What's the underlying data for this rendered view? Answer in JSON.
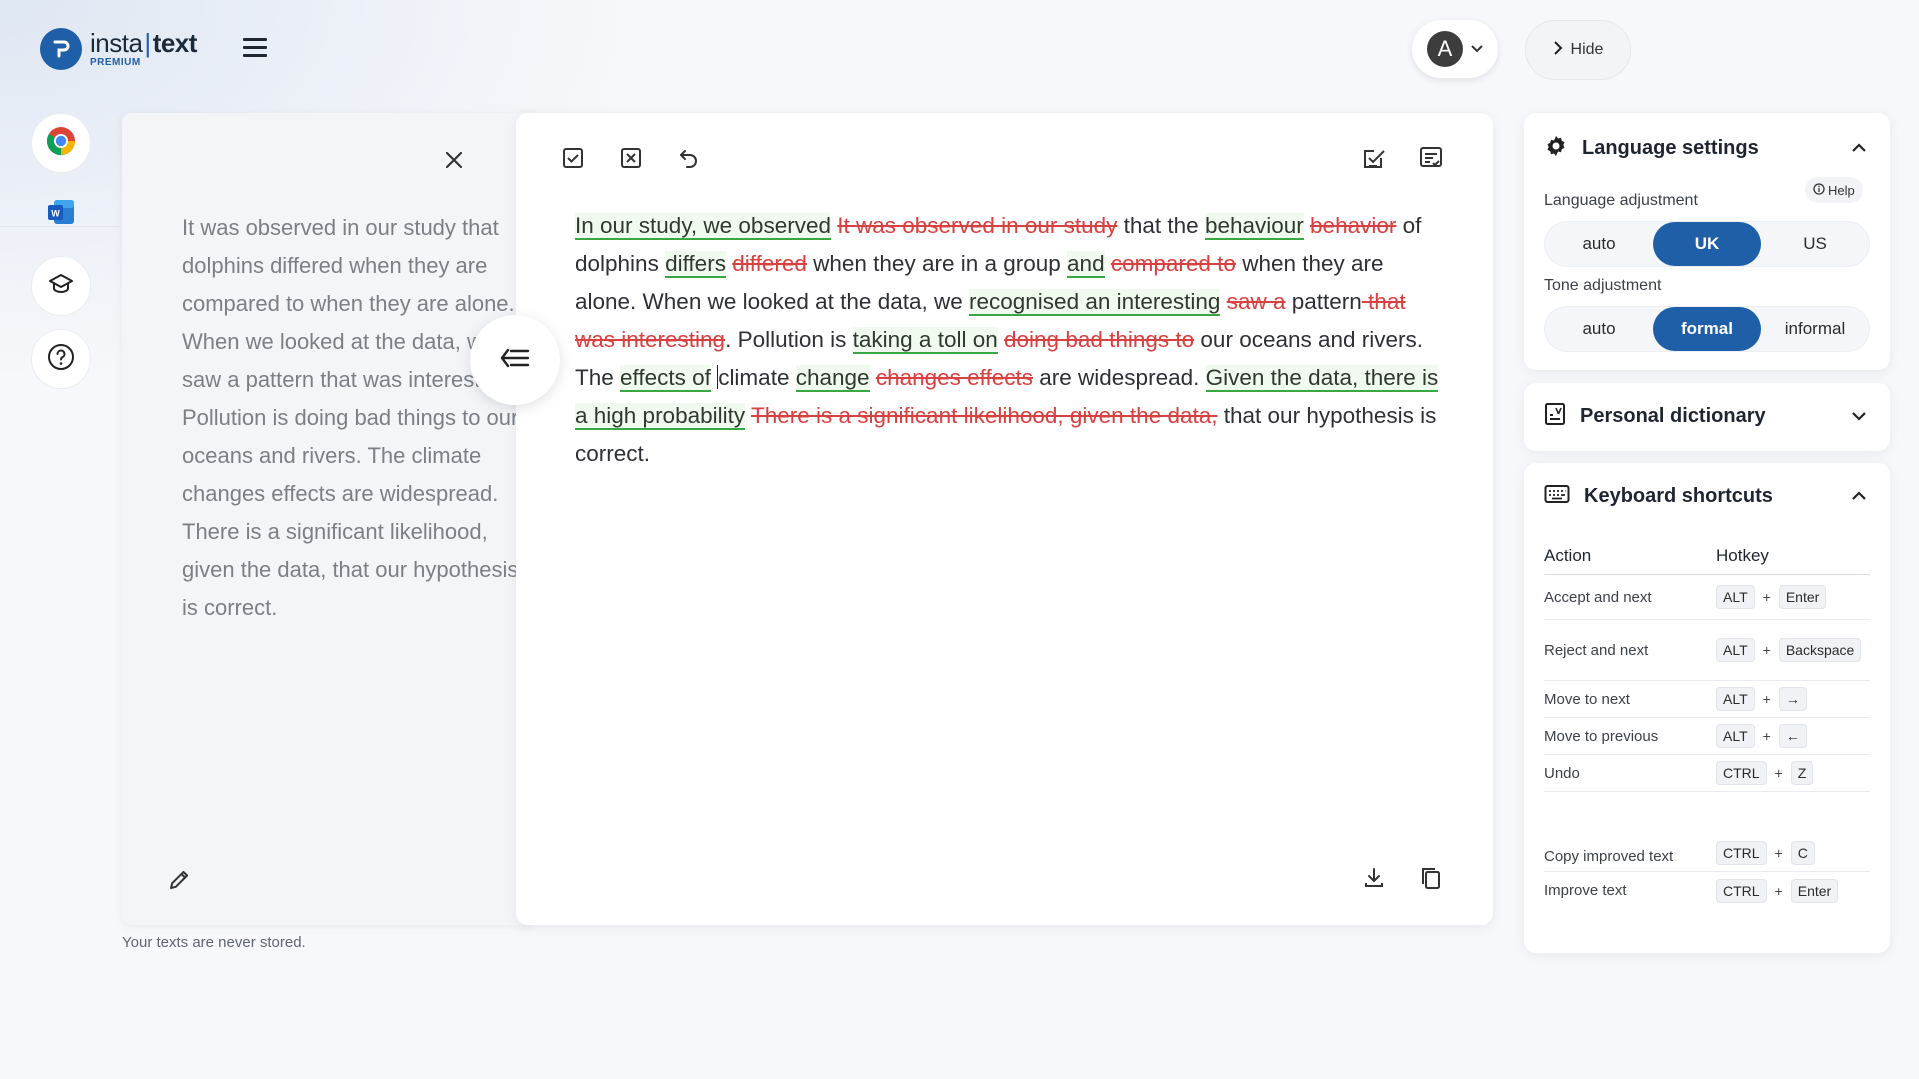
{
  "brand": {
    "name_left": "insta",
    "name_right": "text",
    "tier": "PREMIUM"
  },
  "header": {
    "avatar_letter": "A",
    "hide_label": "Hide"
  },
  "original": {
    "text": "It was observed in our study that dolphins differed when they are compared to when they are alone. When we looked at the data, we saw a pattern that was interesting. Pollution is doing bad things to our oceans and rivers. The climate changes effects are widespread. There is a significant likelihood, given the data, that our hypothesis is correct.",
    "footer_note": "Your texts are never stored."
  },
  "editor": {
    "segments": [
      {
        "t": "ins",
        "v": "In our study, we observed"
      },
      {
        "t": "sp",
        "v": " "
      },
      {
        "t": "del",
        "v": "It was observed in our study"
      },
      {
        "t": "plain",
        "v": " that the "
      },
      {
        "t": "ins",
        "v": "behaviour"
      },
      {
        "t": "sp",
        "v": " "
      },
      {
        "t": "del",
        "v": "behavior"
      },
      {
        "t": "plain",
        "v": " of dolphins "
      },
      {
        "t": "ins",
        "v": "differs"
      },
      {
        "t": "sp",
        "v": " "
      },
      {
        "t": "del",
        "v": "differed"
      },
      {
        "t": "plain",
        "v": " when they are in a group "
      },
      {
        "t": "ins",
        "v": "and"
      },
      {
        "t": "sp",
        "v": " "
      },
      {
        "t": "del",
        "v": "compared to"
      },
      {
        "t": "plain",
        "v": " when they are alone. When we looked at the data, we "
      },
      {
        "t": "ins",
        "v": "recognised an interesting"
      },
      {
        "t": "sp",
        "v": " "
      },
      {
        "t": "del",
        "v": "saw a"
      },
      {
        "t": "plain",
        "v": " pattern"
      },
      {
        "t": "del",
        "v": " that was interesting"
      },
      {
        "t": "plain",
        "v": ". Pollution is "
      },
      {
        "t": "ins",
        "v": "taking a toll on"
      },
      {
        "t": "sp",
        "v": " "
      },
      {
        "t": "del",
        "v": "doing bad things to"
      },
      {
        "t": "plain",
        "v": " our oceans and rivers. The "
      },
      {
        "t": "ins",
        "v": "effects of"
      },
      {
        "t": "sp",
        "v": " "
      },
      {
        "t": "caret",
        "v": ""
      },
      {
        "t": "plain",
        "v": "climate "
      },
      {
        "t": "ins",
        "v": "change"
      },
      {
        "t": "sp",
        "v": " "
      },
      {
        "t": "del",
        "v": "changes effects"
      },
      {
        "t": "plain",
        "v": " are widespread. "
      },
      {
        "t": "ins",
        "v": "Given the data, there is a high probability"
      },
      {
        "t": "sp",
        "v": " "
      },
      {
        "t": "del",
        "v": "There is a significant likelihood, given the data,"
      },
      {
        "t": "plain",
        "v": " that our hypothesis is correct."
      }
    ]
  },
  "language_settings": {
    "title": "Language settings",
    "help_label": "Help",
    "language_adjustment_label": "Language adjustment",
    "language_options": [
      "auto",
      "UK",
      "US"
    ],
    "language_selected": "UK",
    "tone_adjustment_label": "Tone adjustment",
    "tone_options": [
      "auto",
      "formal",
      "informal"
    ],
    "tone_selected": "formal"
  },
  "personal_dictionary": {
    "title": "Personal dictionary"
  },
  "keyboard_shortcuts": {
    "title": "Keyboard shortcuts",
    "col_action": "Action",
    "col_hotkey": "Hotkey",
    "rows": [
      {
        "action": "Accept and next",
        "keys": [
          "ALT",
          "Enter"
        ]
      },
      {
        "action": "Reject and next",
        "keys": [
          "ALT",
          "Backspace"
        ]
      },
      {
        "action": "Move to next",
        "keys": [
          "ALT",
          "→"
        ]
      },
      {
        "action": "Move to previous",
        "keys": [
          "ALT",
          "←"
        ]
      },
      {
        "action": "Undo",
        "keys": [
          "CTRL",
          "Z"
        ]
      },
      {
        "action": "Copy improved text",
        "keys": [
          "CTRL",
          "C"
        ]
      },
      {
        "action": "Improve text",
        "keys": [
          "CTRL",
          "Enter"
        ]
      }
    ]
  },
  "colors": {
    "accent": "#1f5fa8",
    "insert": "#39a842",
    "delete": "#d94040"
  }
}
